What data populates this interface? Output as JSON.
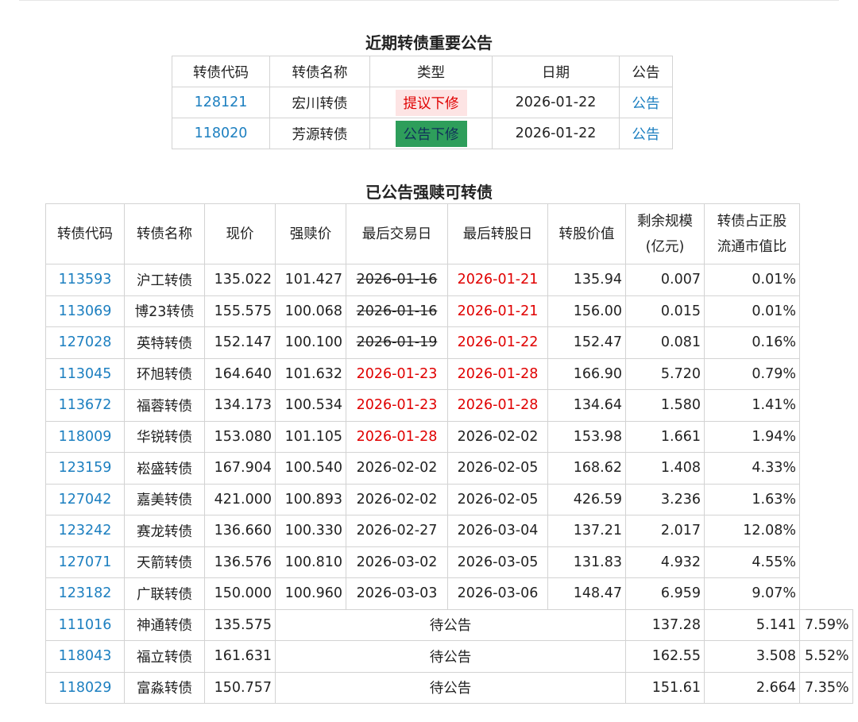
{
  "section1": {
    "title": "近期转债重要公告",
    "headers": [
      "转债代码",
      "转债名称",
      "类型",
      "日期",
      "公告"
    ],
    "rows": [
      {
        "code": "128121",
        "name": "宏川转债",
        "type": "提议下修",
        "type_style": "red",
        "date": "2026-01-22",
        "notice": "公告"
      },
      {
        "code": "118020",
        "name": "芳源转债",
        "type": "公告下修",
        "type_style": "green",
        "date": "2026-01-22",
        "notice": "公告"
      }
    ]
  },
  "section2": {
    "title": "已公告强赎可转债",
    "headers": [
      "转债代码",
      "转债名称",
      "现价",
      "强赎价",
      "最后交易日",
      "最后转股日",
      "转股价值",
      "剩余规模\n(亿元)",
      "转债占正股\n流通市值比"
    ],
    "pending_label": "待公告",
    "rows": [
      {
        "code": "113593",
        "name": "沪工转债",
        "price": "135.022",
        "redeem": "101.427",
        "last_trade": "2026-01-16",
        "last_trade_style": "strike",
        "last_convert": "2026-01-21",
        "last_convert_style": "red",
        "conv_value": "135.94",
        "remaining": "0.007",
        "ratio": "0.01%"
      },
      {
        "code": "113069",
        "name": "博23转债",
        "price": "155.575",
        "redeem": "100.068",
        "last_trade": "2026-01-16",
        "last_trade_style": "strike",
        "last_convert": "2026-01-21",
        "last_convert_style": "red",
        "conv_value": "156.00",
        "remaining": "0.015",
        "ratio": "0.01%"
      },
      {
        "code": "127028",
        "name": "英特转债",
        "price": "152.147",
        "redeem": "100.100",
        "last_trade": "2026-01-19",
        "last_trade_style": "strike",
        "last_convert": "2026-01-22",
        "last_convert_style": "red",
        "conv_value": "152.47",
        "remaining": "0.081",
        "ratio": "0.16%"
      },
      {
        "code": "113045",
        "name": "环旭转债",
        "price": "164.640",
        "redeem": "101.632",
        "last_trade": "2026-01-23",
        "last_trade_style": "red",
        "last_convert": "2026-01-28",
        "last_convert_style": "red",
        "conv_value": "166.90",
        "remaining": "5.720",
        "ratio": "0.79%"
      },
      {
        "code": "113672",
        "name": "福蓉转债",
        "price": "134.173",
        "redeem": "100.534",
        "last_trade": "2026-01-23",
        "last_trade_style": "red",
        "last_convert": "2026-01-28",
        "last_convert_style": "red",
        "conv_value": "134.64",
        "remaining": "1.580",
        "ratio": "1.41%"
      },
      {
        "code": "118009",
        "name": "华锐转债",
        "price": "153.080",
        "redeem": "101.105",
        "last_trade": "2026-01-28",
        "last_trade_style": "red",
        "last_convert": "2026-02-02",
        "last_convert_style": "normal",
        "conv_value": "153.98",
        "remaining": "1.661",
        "ratio": "1.94%"
      },
      {
        "code": "123159",
        "name": "崧盛转债",
        "price": "167.904",
        "redeem": "100.540",
        "last_trade": "2026-02-02",
        "last_trade_style": "normal",
        "last_convert": "2026-02-05",
        "last_convert_style": "normal",
        "conv_value": "168.62",
        "remaining": "1.408",
        "ratio": "4.33%"
      },
      {
        "code": "127042",
        "name": "嘉美转债",
        "price": "421.000",
        "redeem": "100.893",
        "last_trade": "2026-02-02",
        "last_trade_style": "normal",
        "last_convert": "2026-02-05",
        "last_convert_style": "normal",
        "conv_value": "426.59",
        "remaining": "3.236",
        "ratio": "1.63%"
      },
      {
        "code": "123242",
        "name": "赛龙转债",
        "price": "136.660",
        "redeem": "100.330",
        "last_trade": "2026-02-27",
        "last_trade_style": "normal",
        "last_convert": "2026-03-04",
        "last_convert_style": "normal",
        "conv_value": "137.21",
        "remaining": "2.017",
        "ratio": "12.08%"
      },
      {
        "code": "127071",
        "name": "天箭转债",
        "price": "136.576",
        "redeem": "100.810",
        "last_trade": "2026-03-02",
        "last_trade_style": "normal",
        "last_convert": "2026-03-05",
        "last_convert_style": "normal",
        "conv_value": "131.83",
        "remaining": "4.932",
        "ratio": "4.55%"
      },
      {
        "code": "123182",
        "name": "广联转债",
        "price": "150.000",
        "redeem": "100.960",
        "last_trade": "2026-03-03",
        "last_trade_style": "normal",
        "last_convert": "2026-03-06",
        "last_convert_style": "normal",
        "conv_value": "148.47",
        "remaining": "6.959",
        "ratio": "9.07%"
      },
      {
        "code": "111016",
        "name": "神通转债",
        "price": "135.575",
        "pending": true,
        "conv_value": "137.28",
        "remaining": "5.141",
        "ratio": "7.59%"
      },
      {
        "code": "118043",
        "name": "福立转债",
        "price": "161.631",
        "pending": true,
        "conv_value": "162.55",
        "remaining": "3.508",
        "ratio": "5.52%"
      },
      {
        "code": "118029",
        "name": "富淼转债",
        "price": "150.757",
        "pending": true,
        "conv_value": "151.61",
        "remaining": "2.664",
        "ratio": "7.35%"
      }
    ]
  },
  "colors": {
    "link": "#1c7fc0",
    "red": "#e00000",
    "green_tag_bg": "#2e9e5b",
    "red_tag_bg": "#fde4e4",
    "border": "#d3d3d3"
  }
}
